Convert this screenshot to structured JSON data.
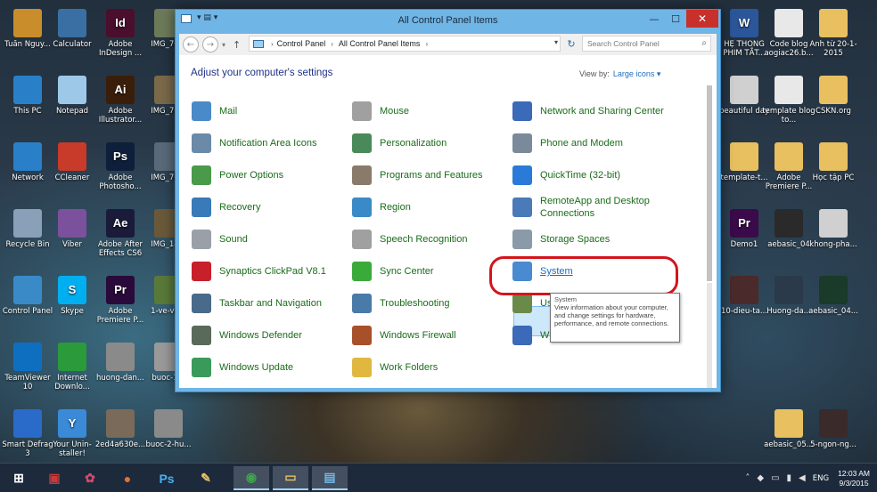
{
  "colors": {
    "accent": "#6fb5e6",
    "link": "#1b6c1b",
    "heading": "#1e3287",
    "highlight": "#d4151a"
  },
  "desktop_icons": [
    {
      "label": "Tuấn Nguy...",
      "icon": "user-folder-icon",
      "color": "#c98d2c"
    },
    {
      "label": "Calculator",
      "icon": "calculator-icon",
      "color": "#3a6fa3"
    },
    {
      "label": "Adobe InDesign ...",
      "icon": "indesign-icon",
      "color": "#4a0f2c",
      "glyph": "Id"
    },
    {
      "label": "IMG_76...",
      "icon": "image-icon",
      "color": "#6d7a5a"
    },
    {
      "label": "This PC",
      "icon": "computer-icon",
      "color": "#2a80c8"
    },
    {
      "label": "Notepad",
      "icon": "notepad-icon",
      "color": "#9ec8e8"
    },
    {
      "label": "Adobe Illustrator...",
      "icon": "illustrator-icon",
      "color": "#3a1e0a",
      "glyph": "Ai"
    },
    {
      "label": "IMG_76...",
      "icon": "image-icon",
      "color": "#7a6a4a"
    },
    {
      "label": "Network",
      "icon": "network-icon",
      "color": "#2a80c8"
    },
    {
      "label": "CCleaner",
      "icon": "ccleaner-icon",
      "color": "#c83a2a"
    },
    {
      "label": "Adobe Photosho...",
      "icon": "photoshop-icon",
      "color": "#0d1f3a",
      "glyph": "Ps"
    },
    {
      "label": "IMG_76...",
      "icon": "image-icon",
      "color": "#5a6a7a"
    },
    {
      "label": "Recycle Bin",
      "icon": "recycle-bin-icon",
      "color": "#8aa0b8"
    },
    {
      "label": "Viber",
      "icon": "viber-icon",
      "color": "#7b519d"
    },
    {
      "label": "Adobe After Effects CS6",
      "icon": "after-effects-icon",
      "color": "#1a1a3a",
      "glyph": "Ae"
    },
    {
      "label": "IMG_14...",
      "icon": "image-icon",
      "color": "#6a5a3a"
    },
    {
      "label": "Control Panel",
      "icon": "control-panel-icon",
      "color": "#3a8ac8"
    },
    {
      "label": "Skype",
      "icon": "skype-icon",
      "color": "#00aff0",
      "glyph": "S"
    },
    {
      "label": "Adobe Premiere P...",
      "icon": "premiere-icon",
      "color": "#2a0a3a",
      "glyph": "Pr"
    },
    {
      "label": "1-ve-ve...",
      "icon": "image-icon",
      "color": "#5a7a3a"
    },
    {
      "label": "TeamViewer 10",
      "icon": "teamviewer-icon",
      "color": "#0e6fc1"
    },
    {
      "label": "Internet Downlo...",
      "icon": "internet-download-icon",
      "color": "#2a9a3a"
    },
    {
      "label": "huong-dan...",
      "icon": "image-icon",
      "color": "#8a8a8a"
    },
    {
      "label": "buoc-1...",
      "icon": "image-icon",
      "color": "#9a9a9a"
    },
    {
      "label": "Smart Defrag 3",
      "icon": "smart-defrag-icon",
      "color": "#2a6ac8"
    },
    {
      "label": "Your Unin-staller!",
      "icon": "uninstaller-icon",
      "color": "#3a8ad8",
      "glyph": "Y"
    },
    {
      "label": "2ed4a630e...",
      "icon": "image-icon",
      "color": "#7a6a5a"
    },
    {
      "label": "buoc-2-hu...",
      "icon": "image-icon",
      "color": "#8a8a8a"
    },
    {
      "label": "HỆ THỐNG PHIM TẮT...",
      "icon": "word-doc-icon",
      "color": "#2b579a",
      "glyph": "W"
    },
    {
      "label": "Code blog aogiac26.b...",
      "icon": "document-icon",
      "color": "#e8e8e8"
    },
    {
      "label": "Ảnh từ 20-1-2015",
      "icon": "folder-icon",
      "color": "#e8c060"
    },
    {
      "label": "beautiful day",
      "icon": "mp3-icon",
      "color": "#d0d0d0"
    },
    {
      "label": "template blog to...",
      "icon": "document-icon",
      "color": "#e8e8e8"
    },
    {
      "label": "CSKN.org",
      "icon": "folder-icon",
      "color": "#e8c060"
    },
    {
      "label": "template-t...",
      "icon": "folder-icon",
      "color": "#e8c060"
    },
    {
      "label": "Adobe Premiere P...",
      "icon": "folder-icon",
      "color": "#e8c060"
    },
    {
      "label": "Học tập PC",
      "icon": "folder-icon",
      "color": "#e8c060"
    },
    {
      "label": "Demo1",
      "icon": "premiere-project-icon",
      "color": "#3a0a4a",
      "glyph": "Pr"
    },
    {
      "label": "aebasic_04",
      "icon": "video-icon",
      "color": "#2a2a2a"
    },
    {
      "label": "khong-pha...",
      "icon": "mp3-icon",
      "color": "#d0d0d0"
    },
    {
      "label": "10-dieu-ta...",
      "icon": "video-icon",
      "color": "#4a2a2a"
    },
    {
      "label": "Huong-da...",
      "icon": "video-icon",
      "color": "#2a3a4a"
    },
    {
      "label": "aebasic_04...",
      "icon": "video-icon",
      "color": "#1a3a2a"
    },
    {
      "label": "aebasic_05...",
      "icon": "folder-icon",
      "color": "#e8c060"
    },
    {
      "label": "5-ngon-ng...",
      "icon": "video-icon",
      "color": "#3a2a2a"
    }
  ],
  "window": {
    "title": "All Control Panel Items",
    "address": {
      "root": "Control Panel",
      "current": "All Control Panel Items"
    },
    "search_placeholder": "Search Control Panel",
    "heading": "Adjust your computer's settings",
    "view_by_label": "View by:",
    "view_by_value": "Large icons ▾",
    "items": [
      {
        "label": "Mail",
        "icon": "mail-icon",
        "color": "#4a8ac8"
      },
      {
        "label": "Notification Area Icons",
        "icon": "notification-area-icon",
        "color": "#6a8aa8"
      },
      {
        "label": "Power Options",
        "icon": "power-options-icon",
        "color": "#4a9a4a"
      },
      {
        "label": "Recovery",
        "icon": "recovery-icon",
        "color": "#3a7ab8"
      },
      {
        "label": "Sound",
        "icon": "sound-icon",
        "color": "#9aa0a8"
      },
      {
        "label": "Synaptics ClickPad V8.1",
        "icon": "synaptics-icon",
        "color": "#c8202a"
      },
      {
        "label": "Taskbar and Navigation",
        "icon": "taskbar-icon",
        "color": "#4a6a8a"
      },
      {
        "label": "Windows Defender",
        "icon": "windows-defender-icon",
        "color": "#5a6a5a"
      },
      {
        "label": "Windows Update",
        "icon": "windows-update-icon",
        "color": "#3a9a5a"
      },
      {
        "label": "Mouse",
        "icon": "mouse-icon",
        "color": "#a0a0a0"
      },
      {
        "label": "Personalization",
        "icon": "personalization-icon",
        "color": "#4a8a5a"
      },
      {
        "label": "Programs and Features",
        "icon": "programs-icon",
        "color": "#8a7a6a"
      },
      {
        "label": "Region",
        "icon": "region-icon",
        "color": "#3a8ac8"
      },
      {
        "label": "Speech Recognition",
        "icon": "microphone-icon",
        "color": "#a0a0a0"
      },
      {
        "label": "Sync Center",
        "icon": "sync-center-icon",
        "color": "#3aaa3a"
      },
      {
        "label": "Troubleshooting",
        "icon": "troubleshooting-icon",
        "color": "#4a7aa8"
      },
      {
        "label": "Windows Firewall",
        "icon": "windows-firewall-icon",
        "color": "#a8502a"
      },
      {
        "label": "Work Folders",
        "icon": "work-folders-icon",
        "color": "#e0b840"
      },
      {
        "label": "Network and Sharing Center",
        "icon": "network-sharing-icon",
        "color": "#3a6ab8"
      },
      {
        "label": "Phone and Modem",
        "icon": "phone-modem-icon",
        "color": "#7a8a9a"
      },
      {
        "label": "QuickTime (32-bit)",
        "icon": "quicktime-icon",
        "color": "#2a7ad8"
      },
      {
        "label": "RemoteApp and Desktop Connections",
        "icon": "remoteapp-icon",
        "color": "#4a7ab8"
      },
      {
        "label": "Storage Spaces",
        "icon": "storage-spaces-icon",
        "color": "#8a9aa8"
      },
      {
        "label": "System",
        "icon": "system-icon",
        "color": "#4a8ad0"
      },
      {
        "label": "Us",
        "icon": "user-accounts-icon",
        "color": "#6a8a4a"
      },
      {
        "label": "W",
        "icon": "windows-mobility-icon",
        "color": "#3a6ab8"
      }
    ],
    "tooltip": {
      "title": "System",
      "text": "View information about your computer, and change settings for hardware, performance, and remote connections."
    }
  },
  "taskbar": {
    "apps": [
      {
        "icon": "windows-start-icon",
        "color": "#ffffff",
        "glyph": "⊞"
      },
      {
        "icon": "app-icon",
        "color": "#c83a3a",
        "glyph": "▣"
      },
      {
        "icon": "app-icon",
        "color": "#d04a6a",
        "glyph": "✿"
      },
      {
        "icon": "firefox-icon",
        "color": "#e8702a",
        "glyph": "●"
      },
      {
        "icon": "photoshop-icon",
        "color": "#4ab0f0",
        "glyph": "Ps"
      },
      {
        "icon": "paint-icon",
        "color": "#e8c060",
        "glyph": "✎"
      },
      {
        "icon": "chrome-icon",
        "color": "#3aa84a",
        "glyph": "◉"
      },
      {
        "icon": "file-explorer-icon",
        "color": "#e8c060",
        "glyph": "▭"
      },
      {
        "icon": "control-panel-icon",
        "color": "#6fb5e6",
        "glyph": "▤"
      }
    ],
    "language": "ENG",
    "time": "12:03 AM",
    "date": "9/3/2015"
  }
}
